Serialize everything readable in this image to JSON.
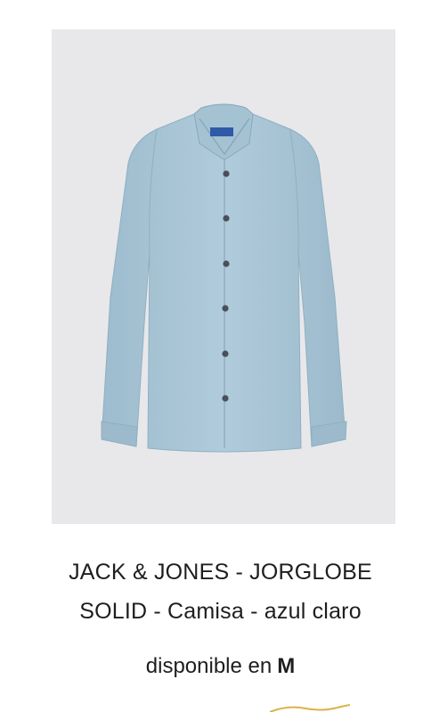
{
  "product": {
    "image_icon": "shirt-image",
    "title_line1": "JACK & JONES - JORGLOBE",
    "title_line2": "SOLID - Camisa - azul claro",
    "availability_prefix": "disponible en",
    "availability_size": "M"
  },
  "colors": {
    "image_bg": "#e8e8ea",
    "shirt": "#a9c5d6",
    "button": "#4b4f5a",
    "text": "#1e1e1e"
  }
}
